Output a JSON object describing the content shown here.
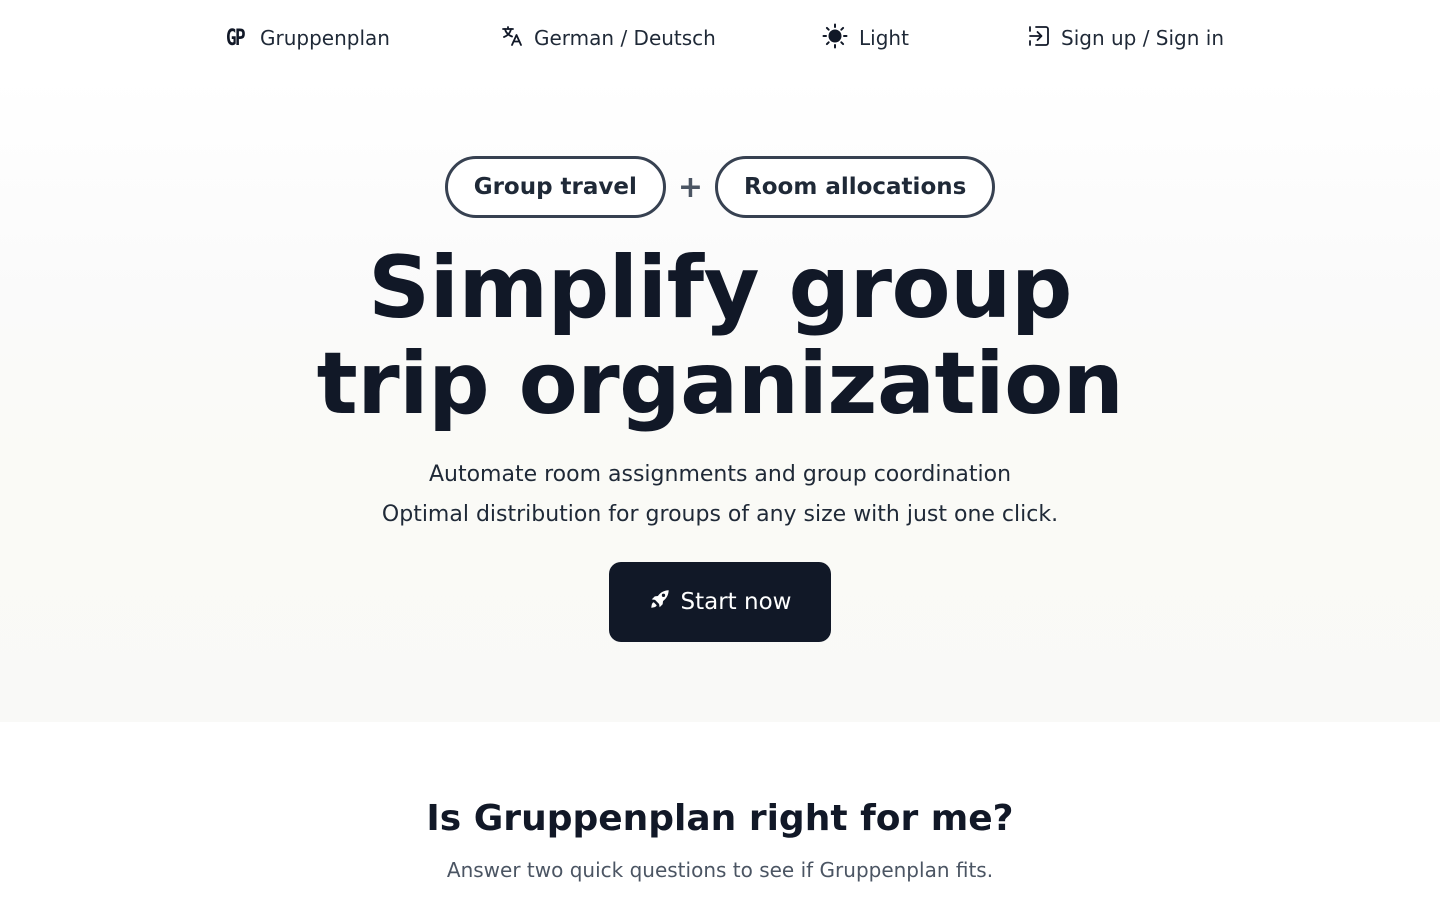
{
  "nav": {
    "brand_logo": "GP",
    "brand_name": "Gruppenplan",
    "language": "German / Deutsch",
    "theme": "Light",
    "auth": "Sign up / Sign in"
  },
  "hero": {
    "pill_1": "Group travel",
    "plus": "+",
    "pill_2": "Room allocations",
    "headline_line_1": "Simplify group",
    "headline_line_2": "trip organization",
    "subtitle_line_1": "Automate room assignments and group coordination",
    "subtitle_line_2": "Optimal distribution for groups of any size with just one click.",
    "cta_label": "Start now"
  },
  "quiz": {
    "title": "Is Gruppenplan right for me?",
    "subtitle": "Answer two quick questions to see if Gruppenplan fits."
  },
  "icons": {
    "language": "translate-icon",
    "theme": "sun-icon",
    "auth": "sign-in-icon",
    "cta": "rocket-icon"
  },
  "colors": {
    "text_primary": "#111827",
    "cta_background": "#111827",
    "pill_border": "#374151",
    "muted_text": "#4b5563"
  }
}
